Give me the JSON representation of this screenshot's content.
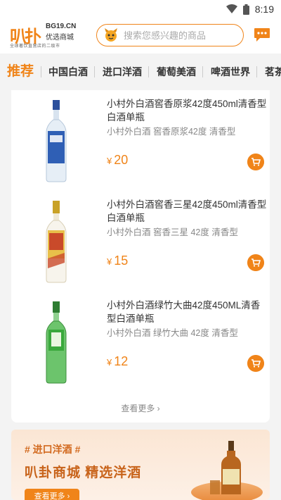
{
  "status": {
    "time": "8:19"
  },
  "header": {
    "logo_mark": "叭扑",
    "logo_domain": "BG19.CN",
    "logo_store": "优选商城",
    "logo_slogan": "全球著饮直营店的二级市",
    "search_placeholder": "搜索您感兴趣的商品"
  },
  "tabs": [
    "推荐",
    "中国白酒",
    "进口洋酒",
    "葡萄美酒",
    "啤酒世界",
    "茗茶"
  ],
  "products": [
    {
      "name": "小村外白酒窖香原浆42度450ml清香型白酒单瓶",
      "spec": "小村外白酒 窖香原浆42度 清香型",
      "currency": "¥",
      "price": "20",
      "bottle_label_color": "#2f5fb5"
    },
    {
      "name": "小村外白酒窖香三星42度450ml清香型白酒单瓶",
      "spec": "小村外白酒 窖香三星 42度 清香型",
      "currency": "¥",
      "price": "15",
      "bottle_label_color": "#c94a2a"
    },
    {
      "name": "小村外白酒绿竹大曲42度450ML清香型白酒单瓶",
      "spec": "小村外白酒 绿竹大曲 42度 清香型",
      "currency": "¥",
      "price": "12",
      "bottle_label_color": "#3aa83c"
    }
  ],
  "more_label": "查看更多",
  "banner": {
    "tag": "# 进口洋酒 #",
    "title": "叭卦商城  精选洋酒",
    "button": "查看更多"
  },
  "colors": {
    "accent": "#f08419",
    "background": "#f3f3f3"
  }
}
